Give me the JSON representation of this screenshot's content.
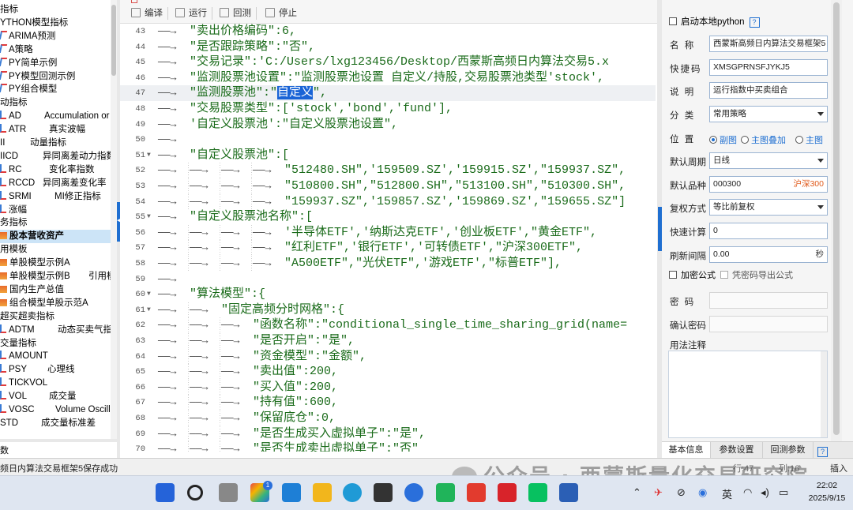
{
  "left_tree": {
    "items": [
      {
        "label": "指标",
        "label2": "",
        "icon": "",
        "selected": false
      },
      {
        "label": "YTHON模型指标",
        "label2": "",
        "icon": "",
        "selected": false
      },
      {
        "label": "ARIMA预测",
        "label2": "",
        "icon": "py",
        "selected": false
      },
      {
        "label": "A策略",
        "label2": "",
        "icon": "py",
        "selected": false
      },
      {
        "label": "PY简单示例",
        "label2": "",
        "icon": "py",
        "selected": false
      },
      {
        "label": "PY模型回测示例",
        "label2": "",
        "icon": "py",
        "selected": false
      },
      {
        "label": "PY组合模型",
        "label2": "",
        "icon": "py",
        "selected": false
      },
      {
        "label": "动指标",
        "label2": "",
        "icon": "",
        "selected": false
      },
      {
        "label": "AD",
        "label2": "Accumulation or",
        "icon": "in",
        "selected": false
      },
      {
        "label": "ATR",
        "label2": "真实波幅",
        "icon": "in",
        "selected": false
      },
      {
        "label": "II",
        "label2": "动量指标",
        "icon": "",
        "selected": false
      },
      {
        "label": "IICD",
        "label2": "异同离差动力指数",
        "icon": "",
        "selected": false
      },
      {
        "label": "RC",
        "label2": "变化率指数",
        "icon": "in",
        "selected": false
      },
      {
        "label": "RCCD",
        "label2": "异同离差变化率",
        "icon": "in",
        "selected": false
      },
      {
        "label": "SRMI",
        "label2": "MI修正指标",
        "icon": "in",
        "selected": false
      },
      {
        "label": "涨幅",
        "label2": "",
        "icon": "in",
        "selected": false
      },
      {
        "label": "务指标",
        "label2": "",
        "icon": "",
        "selected": false
      },
      {
        "label": "股本营收资产",
        "label2": "",
        "icon": "pr",
        "selected": true
      },
      {
        "label": "用模板",
        "label2": "",
        "icon": "",
        "selected": false
      },
      {
        "label": "单股模型示例A",
        "label2": "",
        "icon": "pr",
        "selected": false
      },
      {
        "label": "单股模型示例B",
        "label2": "引用模",
        "icon": "pr",
        "selected": false
      },
      {
        "label": "国内生产总值",
        "label2": "",
        "icon": "pr",
        "selected": false
      },
      {
        "label": "组合模型单股示范A",
        "label2": "",
        "icon": "pr",
        "selected": false
      },
      {
        "label": "超买超卖指标",
        "label2": "",
        "icon": "",
        "selected": false
      },
      {
        "label": "ADTM",
        "label2": "动态买卖气指标",
        "icon": "in",
        "selected": false
      },
      {
        "label": "交量指标",
        "label2": "",
        "icon": "",
        "selected": false
      },
      {
        "label": "AMOUNT",
        "label2": "",
        "icon": "in",
        "selected": false
      },
      {
        "label": "PSY",
        "label2": "心理线",
        "icon": "in",
        "selected": false
      },
      {
        "label": "TICKVOL",
        "label2": "",
        "icon": "in",
        "selected": false
      },
      {
        "label": "VOL",
        "label2": "成交量",
        "icon": "in",
        "selected": false
      },
      {
        "label": "VOSC",
        "label2": "Volume Oscilla",
        "icon": "in",
        "selected": false
      },
      {
        "label": "STD",
        "label2": "成交量标准差",
        "icon": "",
        "selected": false
      }
    ],
    "bottom_label": "数"
  },
  "toolbar": {
    "compile": "编译",
    "run": "运行",
    "backtest": "回测",
    "stop": "停止"
  },
  "code": {
    "lines": [
      {
        "n": "43",
        "fold": false,
        "cur": false,
        "indent": 1,
        "text": "\"卖出价格编码\":6,"
      },
      {
        "n": "44",
        "fold": false,
        "cur": false,
        "indent": 1,
        "text": "\"是否跟踪策略\":\"否\","
      },
      {
        "n": "45",
        "fold": false,
        "cur": false,
        "indent": 1,
        "text": "\"交易记录\":'C:/Users/lxg123456/Desktop/西蒙斯高频日内算法交易5.x"
      },
      {
        "n": "46",
        "fold": false,
        "cur": false,
        "indent": 1,
        "text": "\"监测股票池设置\":\"监测股票池设置 自定义/持股,交易股票池类型'stock',"
      },
      {
        "n": "47",
        "fold": false,
        "cur": true,
        "indent": 1,
        "text": "\"监测股票池\":\"",
        "sel": "自定义",
        "tail": "\","
      },
      {
        "n": "48",
        "fold": false,
        "cur": false,
        "indent": 1,
        "text": "\"交易股票类型\":['stock','bond','fund'],"
      },
      {
        "n": "49",
        "fold": false,
        "cur": false,
        "indent": 1,
        "text": "'自定义股票池':\"自定义股票池设置\","
      },
      {
        "n": "50",
        "fold": false,
        "cur": false,
        "indent": 1,
        "text": ""
      },
      {
        "n": "51",
        "fold": true,
        "cur": false,
        "indent": 1,
        "text": "\"自定义股票池\":["
      },
      {
        "n": "52",
        "fold": false,
        "cur": false,
        "indent": 4,
        "text": "\"512480.SH\",'159509.SZ','159915.SZ',\"159937.SZ\","
      },
      {
        "n": "53",
        "fold": false,
        "cur": false,
        "indent": 4,
        "text": "\"510800.SH\",\"512800.SH\",\"513100.SH\",\"510300.SH\","
      },
      {
        "n": "54",
        "fold": false,
        "cur": false,
        "indent": 4,
        "text": "\"159937.SZ\",'159857.SZ','159869.SZ',\"159655.SZ\"]"
      },
      {
        "n": "55",
        "fold": true,
        "cur": false,
        "indent": 1,
        "text": "\"自定义股票池名称\":["
      },
      {
        "n": "56",
        "fold": false,
        "cur": false,
        "indent": 4,
        "text": "'半导体ETF','纳斯达克ETF','创业板ETF',\"黄金ETF\","
      },
      {
        "n": "57",
        "fold": false,
        "cur": false,
        "indent": 4,
        "text": "\"红利ETF\",'银行ETF','可转债ETF',\"沪深300ETF\","
      },
      {
        "n": "58",
        "fold": false,
        "cur": false,
        "indent": 4,
        "text": "\"A500ETF\",\"光伏ETF\",'游戏ETF',\"标普ETF\"],"
      },
      {
        "n": "59",
        "fold": false,
        "cur": false,
        "indent": 1,
        "text": ""
      },
      {
        "n": "60",
        "fold": true,
        "cur": false,
        "indent": 1,
        "text": "\"算法模型\":{"
      },
      {
        "n": "61",
        "fold": true,
        "cur": false,
        "indent": 2,
        "text": "\"固定高频分时网格\":{"
      },
      {
        "n": "62",
        "fold": false,
        "cur": false,
        "indent": 3,
        "text": "\"函数名称\":\"conditional_single_time_sharing_grid(name="
      },
      {
        "n": "63",
        "fold": false,
        "cur": false,
        "indent": 3,
        "text": "\"是否开启\":\"是\","
      },
      {
        "n": "64",
        "fold": false,
        "cur": false,
        "indent": 3,
        "text": "\"资金模型\":\"金额\","
      },
      {
        "n": "65",
        "fold": false,
        "cur": false,
        "indent": 3,
        "text": "\"卖出值\":200,"
      },
      {
        "n": "66",
        "fold": false,
        "cur": false,
        "indent": 3,
        "text": "\"买入值\":200,"
      },
      {
        "n": "67",
        "fold": false,
        "cur": false,
        "indent": 3,
        "text": "\"持有值\":600,"
      },
      {
        "n": "68",
        "fold": false,
        "cur": false,
        "indent": 3,
        "text": "\"保留底仓\":0,"
      },
      {
        "n": "69",
        "fold": false,
        "cur": false,
        "indent": 3,
        "text": "\"是否生成买入虚拟单子\":\"是\","
      },
      {
        "n": "70",
        "fold": false,
        "cur": false,
        "indent": 3,
        "text": "\"是否生成卖出虚拟单子\":\"否\""
      }
    ]
  },
  "props": {
    "enable_local_python": "启动本地python",
    "help_mark": "?",
    "name_label": "名 称",
    "name_value": "西蒙斯高频日内算法交易框架5",
    "shortcut_label": "快捷码",
    "shortcut_value": "XMSGPRNSFJYKJ5",
    "desc_label": "说 明",
    "desc_value": "运行指数中买卖组合",
    "category_label": "分 类",
    "category_value": "常用策略",
    "position_label": "位 置",
    "position_options": [
      "副图",
      "主图叠加",
      "主图"
    ],
    "position_selected": "副图",
    "period_label": "默认周期",
    "period_value": "日线",
    "symbol_label": "默认品种",
    "symbol_value": "000300",
    "symbol_note": "沪深300",
    "adjust_label": "复权方式",
    "adjust_value": "等比前复权",
    "quickcalc_label": "快速计算",
    "quickcalc_value": "0",
    "refresh_label": "刷新间隔",
    "refresh_value": "0.00",
    "refresh_unit": "秒",
    "encrypt_label": "加密公式",
    "export_label": "凭密码导出公式",
    "password_label": "密 码",
    "confirm_label": "确认密码",
    "notes_label": "用法注释",
    "tabs": [
      "基本信息",
      "参数设置",
      "回测参数"
    ],
    "active_tab": "基本信息",
    "tab_help": "?"
  },
  "status": {
    "message": "频日内算法交易框架5保存成功",
    "right1": "行:47",
    "right2": "列:16",
    "mode": "插入"
  },
  "watermark": "公众号 · 西蒙斯量化交易研究院",
  "taskbar": {
    "badge": "1",
    "tray_lang": "英",
    "time": "22:02",
    "date": "2025/9/15"
  },
  "colors": {
    "code_text": "#1a6b1a",
    "selection": "#1a64d6",
    "accent": "#1f6fd1",
    "tree_selected": "#cce4f7",
    "symbol_note": "#e05a1b"
  }
}
